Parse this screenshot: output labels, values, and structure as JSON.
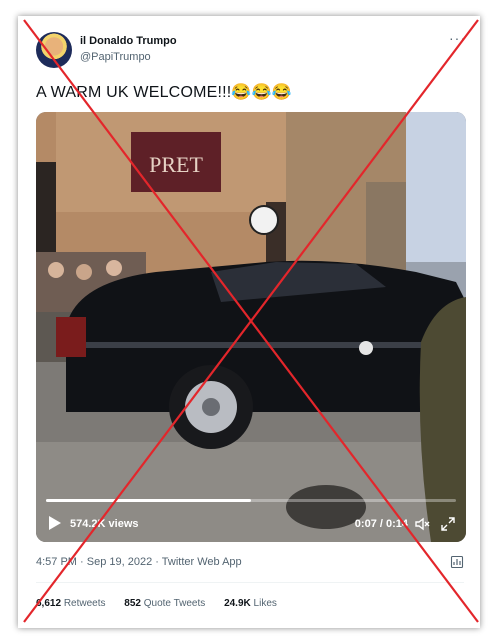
{
  "tweet": {
    "display_name": "il Donaldo Trumpo",
    "handle": "@PapiTrumpo",
    "text": "A WARM UK WELCOME!!!😂😂😂",
    "more_icon": "more-icon",
    "timestamp": "4:57 PM · Sep 19, 2022 · Twitter Web App"
  },
  "video": {
    "views": "574.2K views",
    "time": "0:07 / 0:14",
    "progress": 0.5,
    "shop_sign": "PRET"
  },
  "stats": {
    "retweets_count": "6,612",
    "retweets_label": "Retweets",
    "quotes_count": "852",
    "quotes_label": "Quote Tweets",
    "likes_count": "24.9K",
    "likes_label": "Likes"
  },
  "colors": {
    "cross": "#e3262b",
    "accent_text": "#0f1419",
    "muted_text": "#536471"
  }
}
